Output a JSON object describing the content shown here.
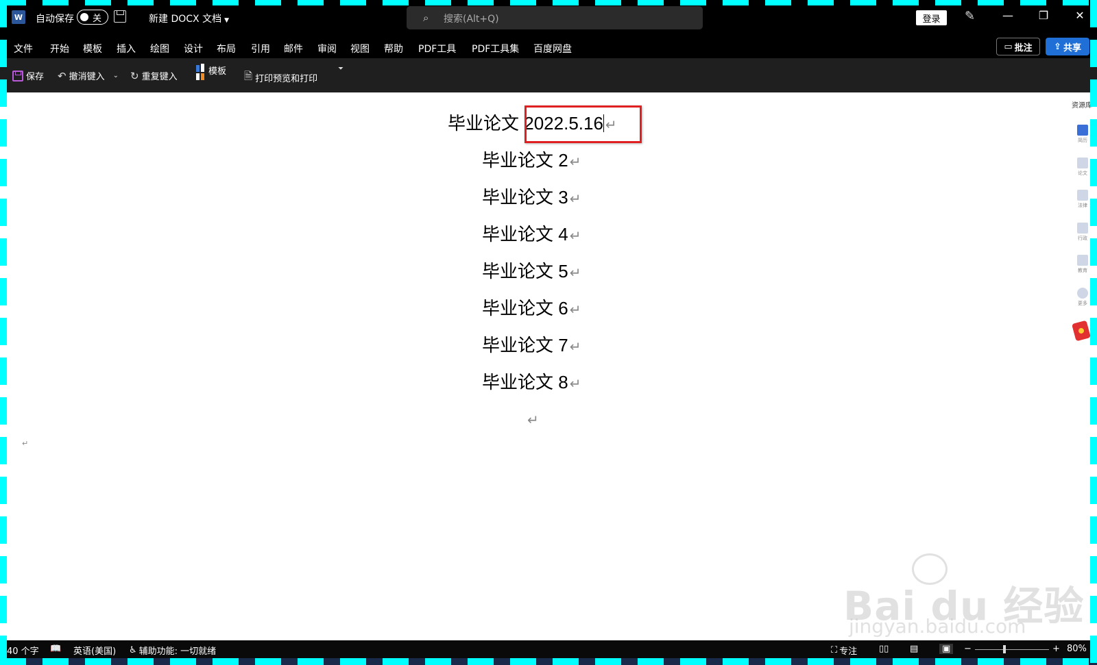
{
  "titlebar": {
    "autosave_label": "自动保存",
    "autosave_state": "关",
    "doc_title": "新建 DOCX 文档",
    "search_placeholder": "搜索(Alt+Q)",
    "login_label": "登录",
    "minimize": "—",
    "restore": "❐",
    "close": "✕"
  },
  "menu": {
    "items": [
      "文件",
      "开始",
      "模板",
      "插入",
      "绘图",
      "设计",
      "布局",
      "引用",
      "邮件",
      "审阅",
      "视图",
      "帮助",
      "PDF工具",
      "PDF工具集",
      "百度网盘"
    ],
    "comment_label": "批注",
    "share_label": "共享"
  },
  "toolbar": {
    "save_label": "保存",
    "undo_label": "撤消键入",
    "redo_label": "重复键入",
    "template_label": "模板",
    "print_label": "打印预览和打印"
  },
  "document": {
    "first_line_prefix": "毕业论文",
    "first_line_date": "2022.5.16",
    "lines": [
      "毕业论文 2",
      "毕业论文 3",
      "毕业论文 4",
      "毕业论文 5",
      "毕业论文 6",
      "毕业论文 7",
      "毕业论文 8"
    ],
    "paragraph_mark": "↵"
  },
  "sidepanel": {
    "title": "资源库",
    "items": [
      "简历",
      "论文",
      "法律",
      "行政",
      "教育",
      "更多"
    ]
  },
  "watermark": {
    "brand": "Bai du 经验",
    "url": "jingyan.baidu.com"
  },
  "status": {
    "word_count": "40 个字",
    "language": "英语(美国)",
    "accessibility": "辅助功能: 一切就绪",
    "focus": "专注",
    "zoom": "80%",
    "zoom_fraction": 0.4
  }
}
